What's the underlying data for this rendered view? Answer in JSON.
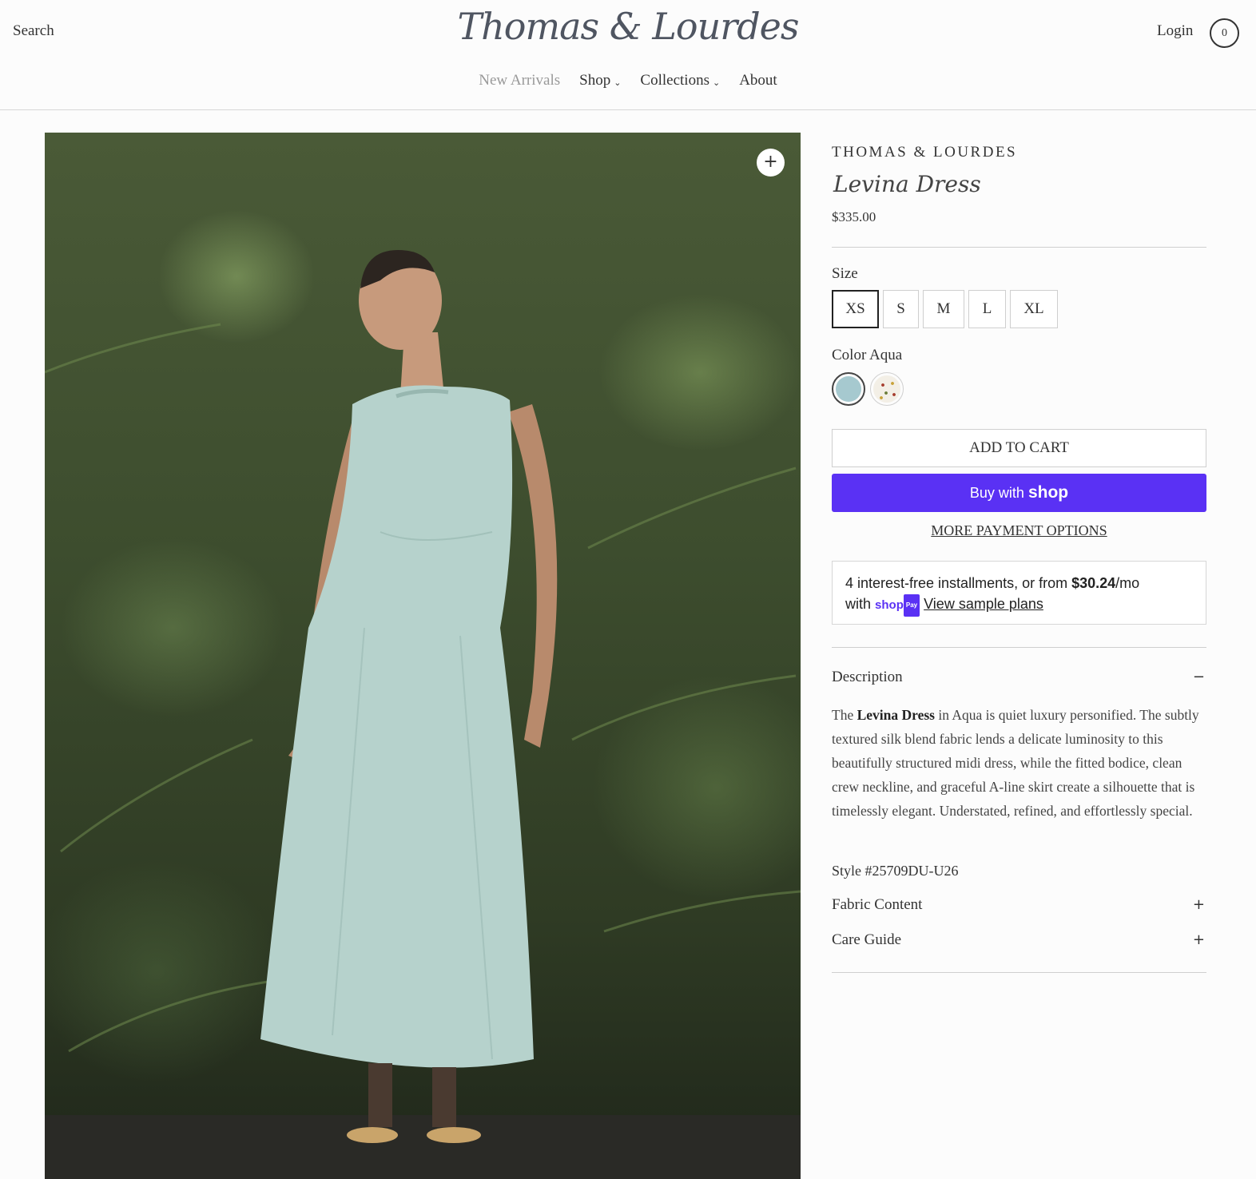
{
  "header": {
    "search_label": "Search",
    "logo_text": "Thomas & Lourdes",
    "login_label": "Login",
    "cart_count": "0",
    "nav": [
      {
        "label": "New Arrivals"
      },
      {
        "label": "Shop"
      },
      {
        "label": "Collections"
      },
      {
        "label": "About"
      }
    ]
  },
  "product": {
    "image_zoom_icon": "plus-icon",
    "brand": "THOMAS & LOURDES",
    "title": "Levina Dress",
    "price": "$335.00",
    "size_label": "Size",
    "sizes": [
      "XS",
      "S",
      "M",
      "L",
      "XL"
    ],
    "selected_size": "XS",
    "color_label": "Color",
    "color_value": "Aqua",
    "colors": [
      {
        "name": "Aqua",
        "hex": "#a6c9cf"
      },
      {
        "name": "Print",
        "hex": "#f3efe6"
      }
    ],
    "add_to_cart": "ADD TO CART",
    "buy_with": "Buy with",
    "buy_shop": "shop",
    "buy_button_color": "#5a31f4",
    "more_payment": "MORE PAYMENT OPTIONS",
    "installments": {
      "prefix": "4 interest-free installments, or from ",
      "amount": "$30.24",
      "suffix": "/mo",
      "with": "with",
      "shop_pay": "shop",
      "pay": "Pay",
      "link": "View sample plans"
    },
    "accordion": {
      "description_label": "Description",
      "description_sign": "−",
      "description_intro": "The ",
      "description_bold": "Levina Dress",
      "description_rest": " in Aqua is quiet luxury personified. The subtly textured silk blend fabric lends a delicate luminosity to this beautifully structured midi dress, while the fitted bodice, clean crew neckline, and graceful A-line skirt create a silhouette that is timelessly elegant. Understated, refined, and effortlessly special.",
      "style_number": "Style #25709DU-U26",
      "fabric_label": "Fabric Content",
      "fabric_sign": "+",
      "care_label": "Care Guide",
      "care_sign": "+"
    }
  }
}
